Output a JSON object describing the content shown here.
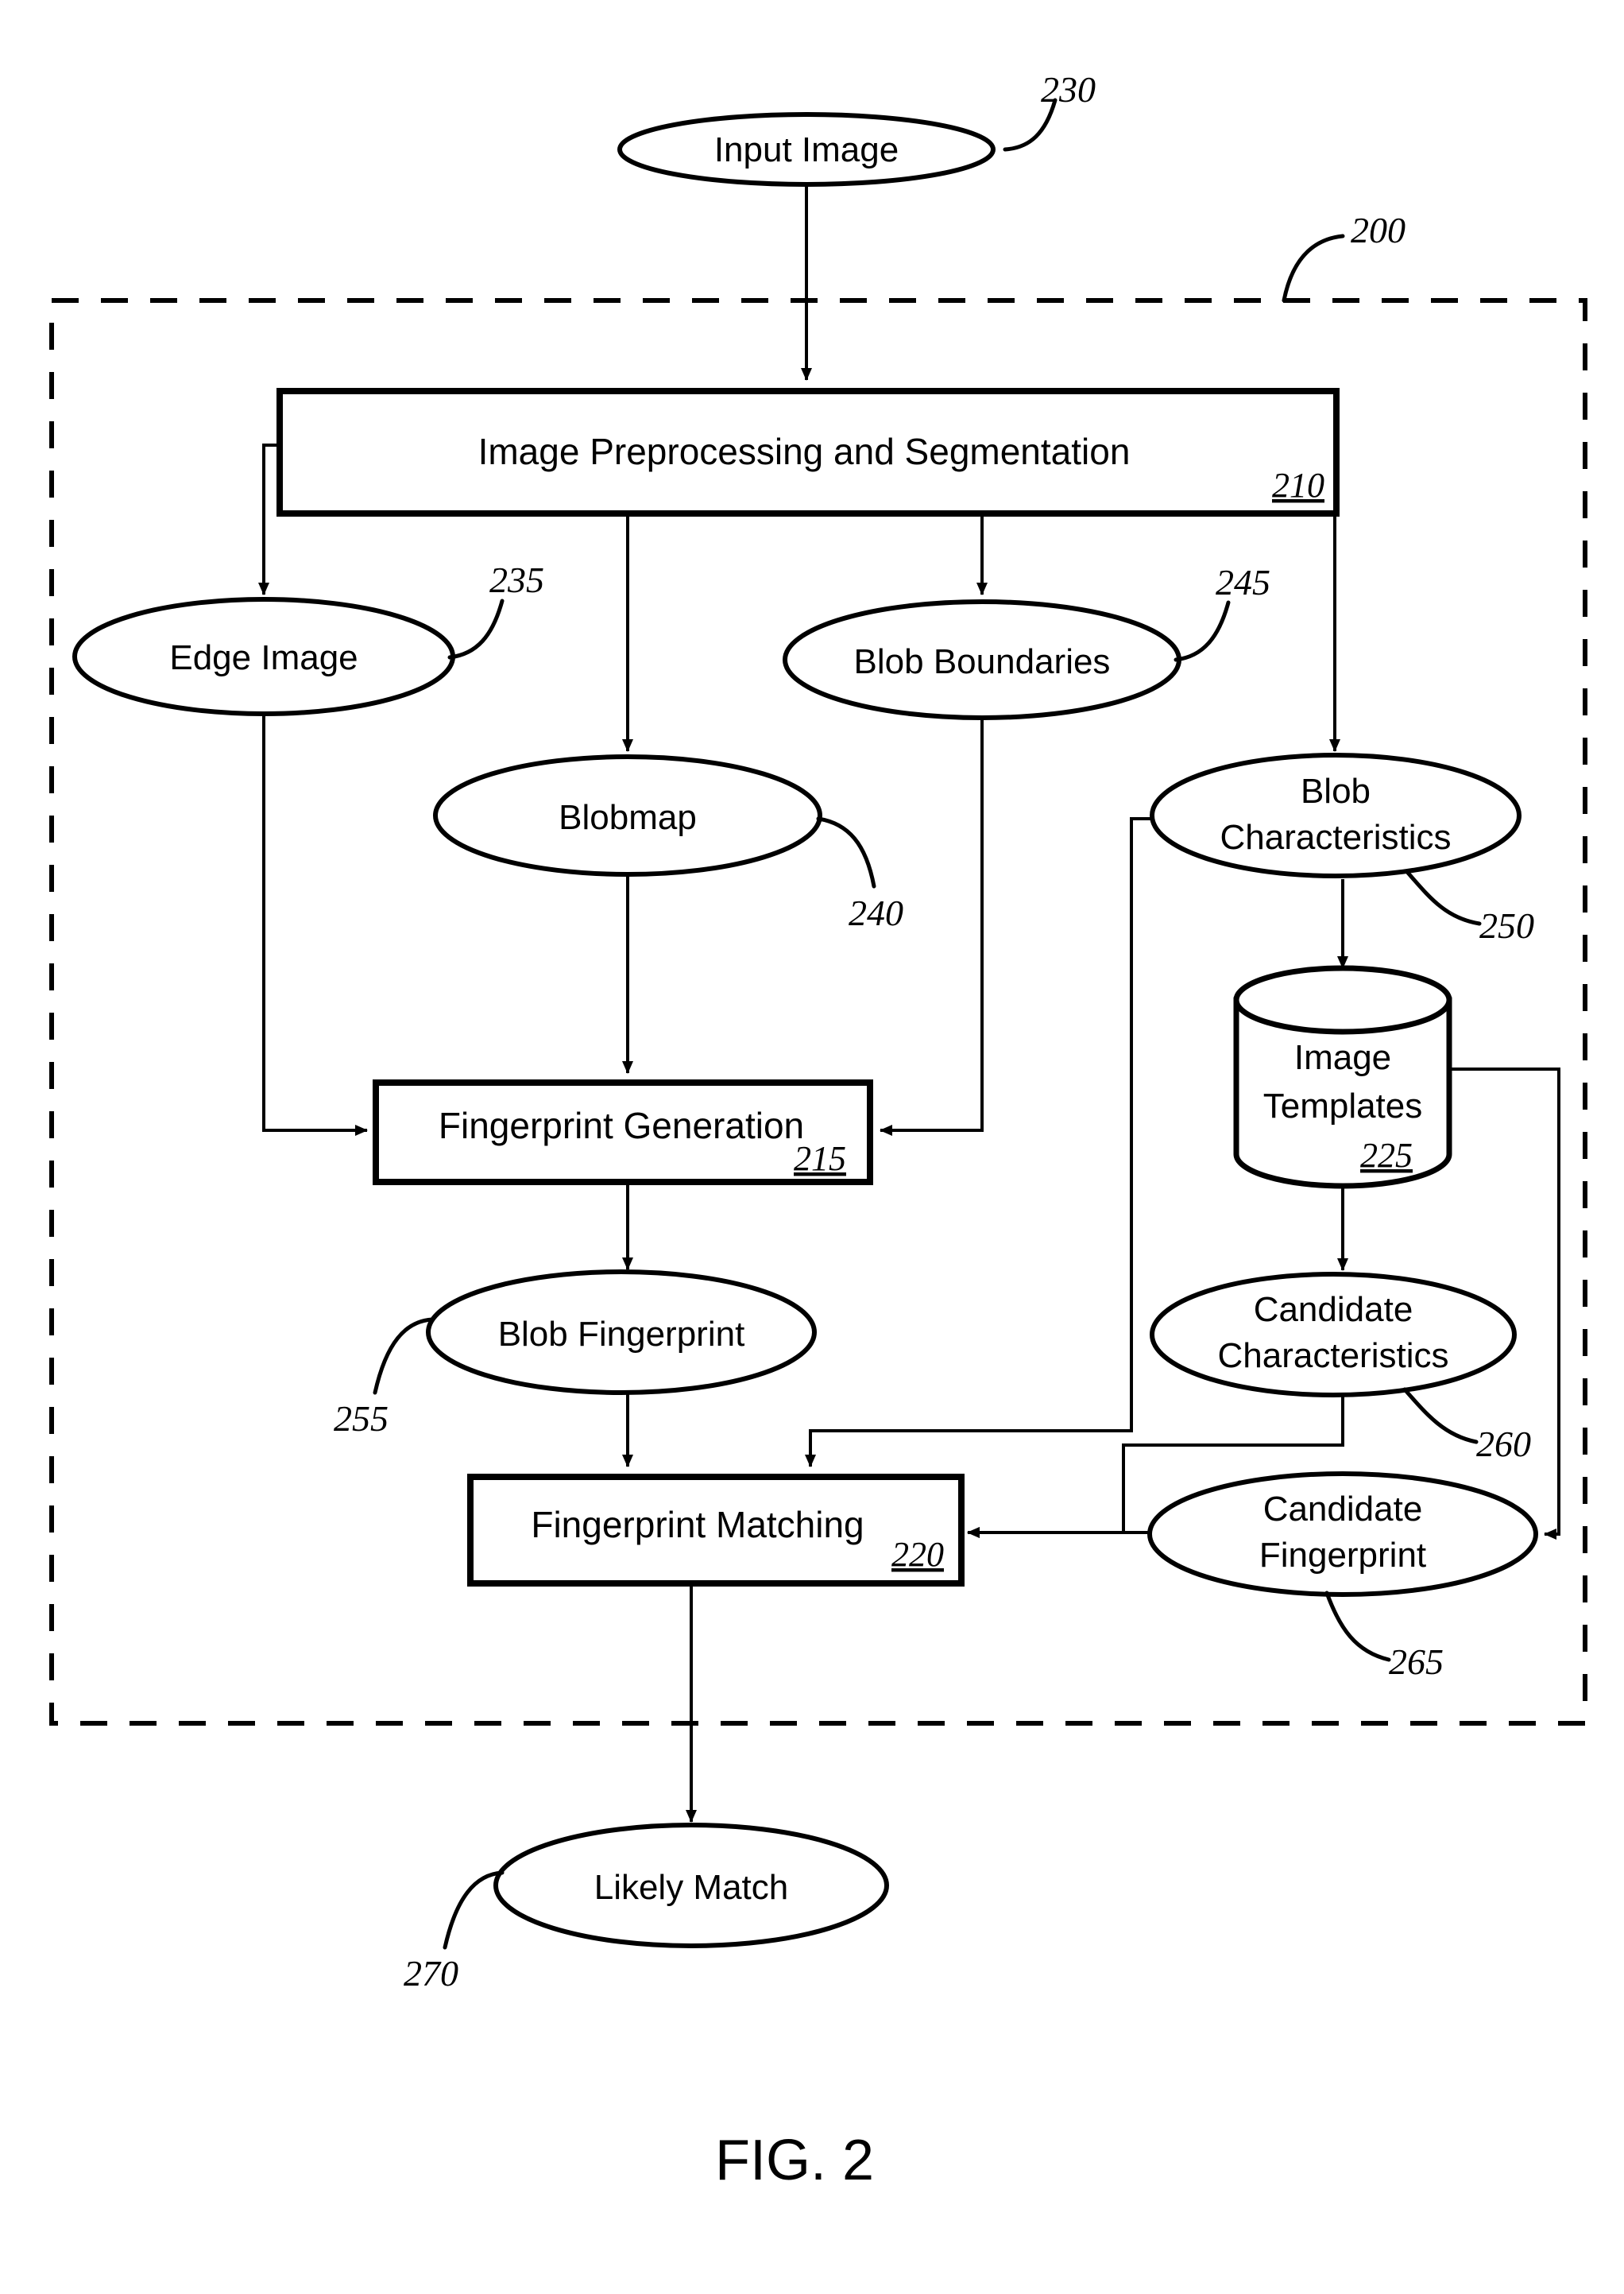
{
  "figure": {
    "caption": "FIG. 2",
    "system_ref": "200"
  },
  "nodes": {
    "input_image": {
      "label": "Input Image",
      "ref": "230",
      "shape": "ellipse"
    },
    "preprocessing": {
      "label": "Image Preprocessing and Segmentation",
      "ref": "210",
      "shape": "process-box"
    },
    "edge_image": {
      "label": "Edge Image",
      "ref": "235",
      "shape": "ellipse"
    },
    "blob_boundaries": {
      "label": "Blob Boundaries",
      "ref": "245",
      "shape": "ellipse"
    },
    "blobmap": {
      "label": "Blobmap",
      "ref": "240",
      "shape": "ellipse"
    },
    "blob_characteristics": {
      "label_line1": "Blob",
      "label_line2": "Characteristics",
      "ref": "250",
      "shape": "ellipse"
    },
    "image_templates": {
      "label_line1": "Image",
      "label_line2": "Templates",
      "ref": "225",
      "shape": "cylinder"
    },
    "fingerprint_generation": {
      "label": "Fingerprint Generation",
      "ref": "215",
      "shape": "process-box"
    },
    "blob_fingerprint": {
      "label": "Blob Fingerprint",
      "ref": "255",
      "shape": "ellipse"
    },
    "candidate_characteristics": {
      "label_line1": "Candidate",
      "label_line2": "Characteristics",
      "ref": "260",
      "shape": "ellipse"
    },
    "fingerprint_matching": {
      "label": "Fingerprint Matching",
      "ref": "220",
      "shape": "process-box"
    },
    "candidate_fingerprint": {
      "label_line1": "Candidate",
      "label_line2": "Fingerprint",
      "ref": "265",
      "shape": "ellipse"
    },
    "likely_match": {
      "label": "Likely Match",
      "ref": "270",
      "shape": "ellipse"
    }
  },
  "colors": {
    "stroke": "#000000",
    "fill": "#ffffff",
    "background": "#ffffff"
  }
}
